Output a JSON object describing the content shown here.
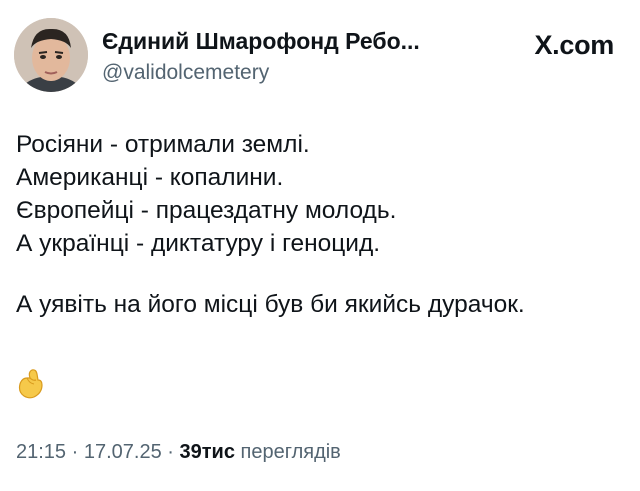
{
  "author": {
    "display_name": "Єдиний Шмарофонд Ребо...",
    "handle": "@validolcemetery",
    "avatar_icon": "profile-photo"
  },
  "brand": {
    "domain": "X.com",
    "icon": "x-logo-icon"
  },
  "tweet": {
    "lines": [
      "Росіяни - отримали землі.",
      "Американці - копалини.",
      "Європейці - працездатну молодь.",
      "А українці - диктатуру і геноцид."
    ],
    "closing": "А уявіть на його місці був би якийсь дурачок.",
    "emoji": "pinching-hand-icon"
  },
  "meta": {
    "time": "21:15",
    "sep1": " · ",
    "date": "17.07.25",
    "sep2": " · ",
    "views": "39тис",
    "views_label": " переглядів"
  },
  "colors": {
    "text": "#0f1419",
    "secondary": "#536471",
    "emoji_yellow": "#f6c94a"
  }
}
